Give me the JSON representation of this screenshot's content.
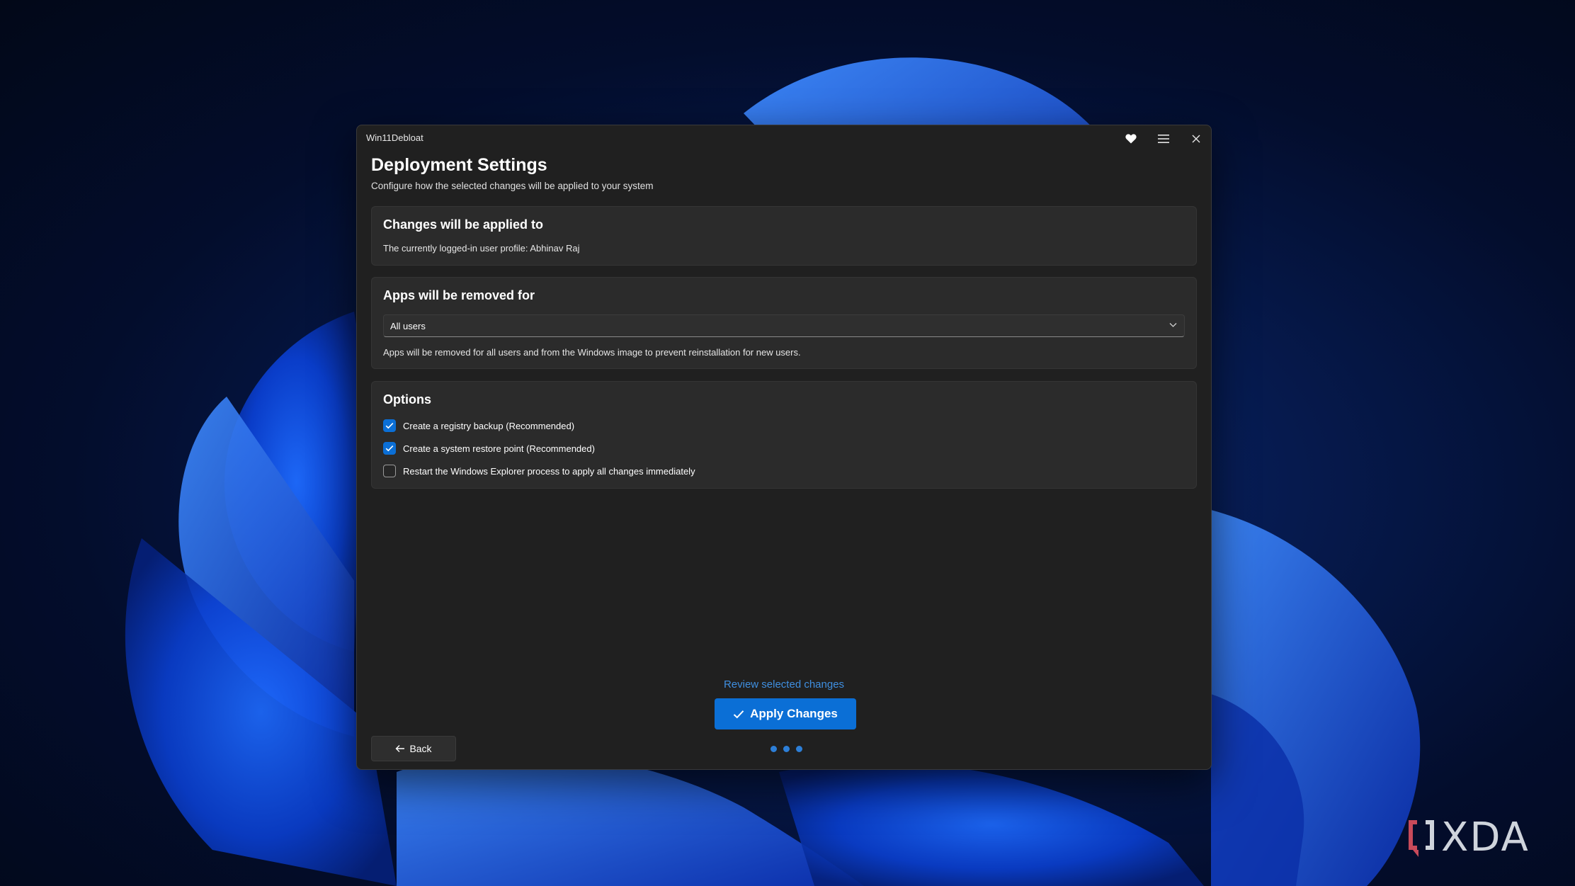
{
  "window": {
    "app_title": "Win11Debloat"
  },
  "header": {
    "title": "Deployment Settings",
    "subtitle": "Configure how the selected changes will be applied to your system"
  },
  "applied_card": {
    "title": "Changes will be applied to",
    "text": "The currently logged-in user profile: Abhinav Raj"
  },
  "removed_card": {
    "title": "Apps will be removed for",
    "selected_value": "All users",
    "description": "Apps will be removed for all users and from the Windows image to prevent reinstallation for new users."
  },
  "options_card": {
    "title": "Options",
    "items": [
      {
        "label": "Create a registry backup (Recommended)",
        "checked": true
      },
      {
        "label": "Create a system restore point (Recommended)",
        "checked": true
      },
      {
        "label": "Restart the Windows Explorer process to apply all changes immediately",
        "checked": false
      }
    ]
  },
  "footer": {
    "review_link": "Review selected changes",
    "apply_label": "Apply Changes",
    "back_label": "Back",
    "page_dots": 3
  },
  "watermark": {
    "brand": "XDA"
  },
  "colors": {
    "accent": "#0b6fd6",
    "link": "#3f8fe0",
    "window_bg": "#202020",
    "card_bg": "#2b2b2b"
  },
  "icons": {
    "titlebar": [
      "heart-icon",
      "hamburger-menu-icon",
      "close-icon"
    ],
    "select": "chevron-down-icon",
    "apply": "checkmark-icon",
    "back": "arrow-left-icon"
  }
}
